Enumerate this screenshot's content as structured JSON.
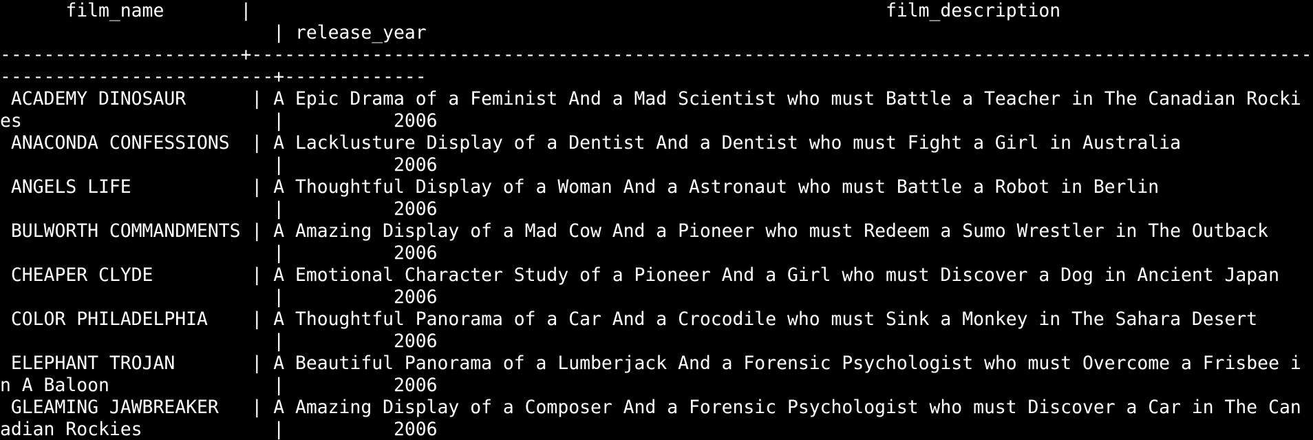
{
  "terminal": {
    "lines": [
      "      film_name       |                                                          film_description",
      "                         | release_year",
      "----------------------+------------------------------------------------------------------------------------------------------------------",
      "-------------------------+-------------",
      " ACADEMY DINOSAUR      | A Epic Drama of a Feminist And a Mad Scientist who must Battle a Teacher in The Canadian Rocki",
      "es                       |          2006",
      " ANACONDA CONFESSIONS  | A Lacklusture Display of a Dentist And a Dentist who must Fight a Girl in Australia",
      "                         |          2006",
      " ANGELS LIFE           | A Thoughtful Display of a Woman And a Astronaut who must Battle a Robot in Berlin",
      "                         |          2006",
      " BULWORTH COMMANDMENTS | A Amazing Display of a Mad Cow And a Pioneer who must Redeem a Sumo Wrestler in The Outback",
      "                         |          2006",
      " CHEAPER CLYDE         | A Emotional Character Study of a Pioneer And a Girl who must Discover a Dog in Ancient Japan",
      "                         |          2006",
      " COLOR PHILADELPHIA    | A Thoughtful Panorama of a Car And a Crocodile who must Sink a Monkey in The Sahara Desert",
      "                         |          2006",
      " ELEPHANT TROJAN       | A Beautiful Panorama of a Lumberjack And a Forensic Psychologist who must Overcome a Frisbee i",
      "n A Baloon               |          2006",
      " GLEAMING JAWBREAKER   | A Amazing Display of a Composer And a Forensic Psychologist who must Discover a Car in The Can",
      "adian Rockies            |          2006"
    ]
  }
}
